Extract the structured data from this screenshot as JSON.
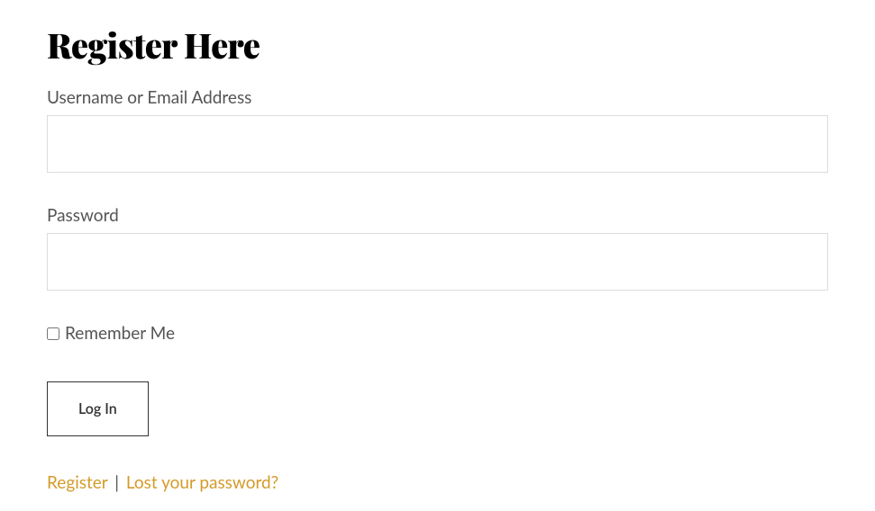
{
  "heading": "Register Here",
  "form": {
    "username_label": "Username or Email Address",
    "username_value": "",
    "password_label": "Password",
    "password_value": "",
    "remember_label": "Remember Me",
    "submit_label": "Log In"
  },
  "links": {
    "register_label": "Register",
    "divider": "|",
    "lost_password_label": "Lost your password?"
  }
}
